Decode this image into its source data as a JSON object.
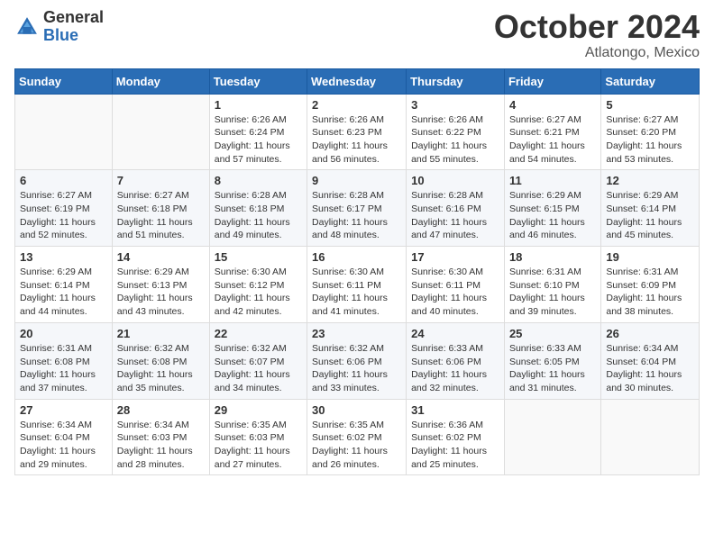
{
  "logo": {
    "general": "General",
    "blue": "Blue"
  },
  "header": {
    "month": "October 2024",
    "location": "Atlatongo, Mexico"
  },
  "days_header": [
    "Sunday",
    "Monday",
    "Tuesday",
    "Wednesday",
    "Thursday",
    "Friday",
    "Saturday"
  ],
  "weeks": [
    [
      {
        "day": "",
        "sunrise": "",
        "sunset": "",
        "daylight": ""
      },
      {
        "day": "",
        "sunrise": "",
        "sunset": "",
        "daylight": ""
      },
      {
        "day": "1",
        "sunrise": "Sunrise: 6:26 AM",
        "sunset": "Sunset: 6:24 PM",
        "daylight": "Daylight: 11 hours and 57 minutes."
      },
      {
        "day": "2",
        "sunrise": "Sunrise: 6:26 AM",
        "sunset": "Sunset: 6:23 PM",
        "daylight": "Daylight: 11 hours and 56 minutes."
      },
      {
        "day": "3",
        "sunrise": "Sunrise: 6:26 AM",
        "sunset": "Sunset: 6:22 PM",
        "daylight": "Daylight: 11 hours and 55 minutes."
      },
      {
        "day": "4",
        "sunrise": "Sunrise: 6:27 AM",
        "sunset": "Sunset: 6:21 PM",
        "daylight": "Daylight: 11 hours and 54 minutes."
      },
      {
        "day": "5",
        "sunrise": "Sunrise: 6:27 AM",
        "sunset": "Sunset: 6:20 PM",
        "daylight": "Daylight: 11 hours and 53 minutes."
      }
    ],
    [
      {
        "day": "6",
        "sunrise": "Sunrise: 6:27 AM",
        "sunset": "Sunset: 6:19 PM",
        "daylight": "Daylight: 11 hours and 52 minutes."
      },
      {
        "day": "7",
        "sunrise": "Sunrise: 6:27 AM",
        "sunset": "Sunset: 6:18 PM",
        "daylight": "Daylight: 11 hours and 51 minutes."
      },
      {
        "day": "8",
        "sunrise": "Sunrise: 6:28 AM",
        "sunset": "Sunset: 6:18 PM",
        "daylight": "Daylight: 11 hours and 49 minutes."
      },
      {
        "day": "9",
        "sunrise": "Sunrise: 6:28 AM",
        "sunset": "Sunset: 6:17 PM",
        "daylight": "Daylight: 11 hours and 48 minutes."
      },
      {
        "day": "10",
        "sunrise": "Sunrise: 6:28 AM",
        "sunset": "Sunset: 6:16 PM",
        "daylight": "Daylight: 11 hours and 47 minutes."
      },
      {
        "day": "11",
        "sunrise": "Sunrise: 6:29 AM",
        "sunset": "Sunset: 6:15 PM",
        "daylight": "Daylight: 11 hours and 46 minutes."
      },
      {
        "day": "12",
        "sunrise": "Sunrise: 6:29 AM",
        "sunset": "Sunset: 6:14 PM",
        "daylight": "Daylight: 11 hours and 45 minutes."
      }
    ],
    [
      {
        "day": "13",
        "sunrise": "Sunrise: 6:29 AM",
        "sunset": "Sunset: 6:14 PM",
        "daylight": "Daylight: 11 hours and 44 minutes."
      },
      {
        "day": "14",
        "sunrise": "Sunrise: 6:29 AM",
        "sunset": "Sunset: 6:13 PM",
        "daylight": "Daylight: 11 hours and 43 minutes."
      },
      {
        "day": "15",
        "sunrise": "Sunrise: 6:30 AM",
        "sunset": "Sunset: 6:12 PM",
        "daylight": "Daylight: 11 hours and 42 minutes."
      },
      {
        "day": "16",
        "sunrise": "Sunrise: 6:30 AM",
        "sunset": "Sunset: 6:11 PM",
        "daylight": "Daylight: 11 hours and 41 minutes."
      },
      {
        "day": "17",
        "sunrise": "Sunrise: 6:30 AM",
        "sunset": "Sunset: 6:11 PM",
        "daylight": "Daylight: 11 hours and 40 minutes."
      },
      {
        "day": "18",
        "sunrise": "Sunrise: 6:31 AM",
        "sunset": "Sunset: 6:10 PM",
        "daylight": "Daylight: 11 hours and 39 minutes."
      },
      {
        "day": "19",
        "sunrise": "Sunrise: 6:31 AM",
        "sunset": "Sunset: 6:09 PM",
        "daylight": "Daylight: 11 hours and 38 minutes."
      }
    ],
    [
      {
        "day": "20",
        "sunrise": "Sunrise: 6:31 AM",
        "sunset": "Sunset: 6:08 PM",
        "daylight": "Daylight: 11 hours and 37 minutes."
      },
      {
        "day": "21",
        "sunrise": "Sunrise: 6:32 AM",
        "sunset": "Sunset: 6:08 PM",
        "daylight": "Daylight: 11 hours and 35 minutes."
      },
      {
        "day": "22",
        "sunrise": "Sunrise: 6:32 AM",
        "sunset": "Sunset: 6:07 PM",
        "daylight": "Daylight: 11 hours and 34 minutes."
      },
      {
        "day": "23",
        "sunrise": "Sunrise: 6:32 AM",
        "sunset": "Sunset: 6:06 PM",
        "daylight": "Daylight: 11 hours and 33 minutes."
      },
      {
        "day": "24",
        "sunrise": "Sunrise: 6:33 AM",
        "sunset": "Sunset: 6:06 PM",
        "daylight": "Daylight: 11 hours and 32 minutes."
      },
      {
        "day": "25",
        "sunrise": "Sunrise: 6:33 AM",
        "sunset": "Sunset: 6:05 PM",
        "daylight": "Daylight: 11 hours and 31 minutes."
      },
      {
        "day": "26",
        "sunrise": "Sunrise: 6:34 AM",
        "sunset": "Sunset: 6:04 PM",
        "daylight": "Daylight: 11 hours and 30 minutes."
      }
    ],
    [
      {
        "day": "27",
        "sunrise": "Sunrise: 6:34 AM",
        "sunset": "Sunset: 6:04 PM",
        "daylight": "Daylight: 11 hours and 29 minutes."
      },
      {
        "day": "28",
        "sunrise": "Sunrise: 6:34 AM",
        "sunset": "Sunset: 6:03 PM",
        "daylight": "Daylight: 11 hours and 28 minutes."
      },
      {
        "day": "29",
        "sunrise": "Sunrise: 6:35 AM",
        "sunset": "Sunset: 6:03 PM",
        "daylight": "Daylight: 11 hours and 27 minutes."
      },
      {
        "day": "30",
        "sunrise": "Sunrise: 6:35 AM",
        "sunset": "Sunset: 6:02 PM",
        "daylight": "Daylight: 11 hours and 26 minutes."
      },
      {
        "day": "31",
        "sunrise": "Sunrise: 6:36 AM",
        "sunset": "Sunset: 6:02 PM",
        "daylight": "Daylight: 11 hours and 25 minutes."
      },
      {
        "day": "",
        "sunrise": "",
        "sunset": "",
        "daylight": ""
      },
      {
        "day": "",
        "sunrise": "",
        "sunset": "",
        "daylight": ""
      }
    ]
  ]
}
